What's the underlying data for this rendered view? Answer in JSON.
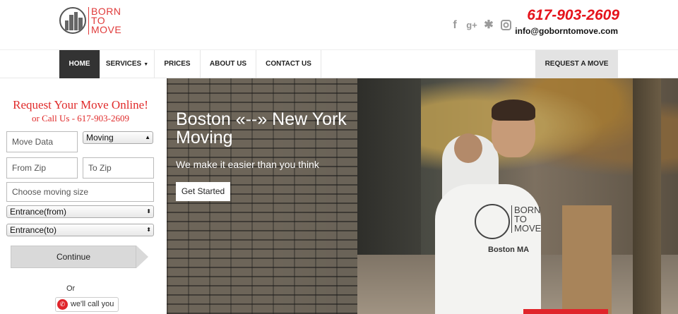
{
  "header": {
    "logo_text": [
      "BORN",
      "TO",
      "MOVE"
    ],
    "phone": "617-903-2609",
    "email": "info@goborntomove.com",
    "social": [
      "facebook-icon",
      "google-plus-icon",
      "yelp-icon",
      "instagram-icon"
    ]
  },
  "nav": {
    "items": [
      {
        "label": "HOME",
        "active": true
      },
      {
        "label": "SERVICES",
        "has_dropdown": true
      },
      {
        "label": "PRICES"
      },
      {
        "label": "ABOUT US"
      },
      {
        "label": "CONTACT US"
      }
    ],
    "request": "REQUEST A MOVE"
  },
  "form": {
    "title": "Request Your Move Online!",
    "subtitle": "or Call Us - 617-903-2609",
    "move_date_placeholder": "Move Data",
    "move_type": "Moving",
    "from_zip_placeholder": "From Zip",
    "to_zip_placeholder": "To Zip",
    "size_placeholder": "Choose moving size",
    "entrance_from": "Entrance(from)",
    "entrance_to": "Entrance(to)",
    "continue": "Continue",
    "or": "Or",
    "call_button": "we'll call you"
  },
  "hero": {
    "title": "Boston «--» New York Moving",
    "subtitle": "We make it easier than you think",
    "cta": "Get Started",
    "shirt_logo": [
      "BORN",
      "TO",
      "MOVE"
    ],
    "shirt_city": "Boston MA"
  },
  "colors": {
    "accent_red": "#e5141c",
    "nav_active": "#333333",
    "button_gray": "#d9d9d9"
  }
}
